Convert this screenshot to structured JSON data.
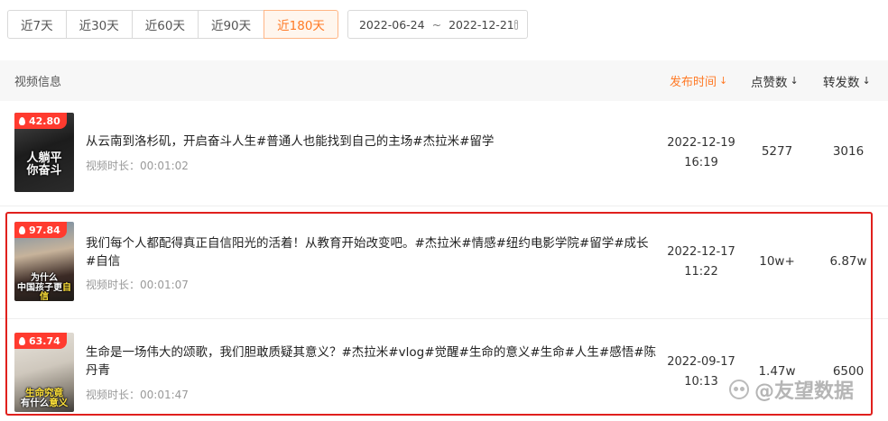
{
  "filters": {
    "ranges": [
      "近7天",
      "近30天",
      "近60天",
      "近90天",
      "近180天"
    ],
    "active_range": "近180天",
    "date_start": "2022-06-24",
    "date_separator": "~",
    "date_end": "2022-12-21"
  },
  "table": {
    "col_info": "视频信息",
    "col_publish": "发布时间",
    "col_likes": "点赞数",
    "col_shares": "转发数",
    "sort_arrow": "↓",
    "rows": [
      {
        "score": "42.80",
        "thumb_caption_line1": "人躺平",
        "thumb_caption_line2": "你奋斗",
        "title": "从云南到洛杉矶，开启奋斗人生#普通人也能找到自己的主场#杰拉米#留学",
        "duration": "视频时长：00:01:02",
        "publish_date": "2022-12-19",
        "publish_time": "16:19",
        "likes": "5277",
        "shares": "3016"
      },
      {
        "score": "97.84",
        "thumb_caption_line1": "为什么",
        "thumb_caption_line2": "中国孩子更",
        "thumb_caption_highlight": "自信",
        "title_line1": "我们每个人都配得真正自信阳光的活着！从教育开始改变吧。#杰拉米#情感#纽约电影学院#留学#成长",
        "title_line2": "#自信",
        "duration": "视频时长：00:01:07",
        "publish_date": "2022-12-17",
        "publish_time": "11:22",
        "likes": "10w+",
        "shares": "6.87w"
      },
      {
        "score": "63.74",
        "thumb_caption_line1": "生命究竟",
        "thumb_caption_line2": "有什么",
        "thumb_caption_highlight": "意义",
        "title_line1": "生命是一场伟大的颂歌，我们胆敢质疑其意义？#杰拉米#vlog#觉醒#生命的意义#生命#人生#感悟#陈",
        "title_line2": "丹青",
        "duration": "视频时长：00:01:47",
        "publish_date": "2022-09-17",
        "publish_time": "10:13",
        "likes": "1.47w",
        "shares": "6500"
      }
    ]
  },
  "watermark": {
    "text": "@友望数据"
  },
  "colors": {
    "accent": "#ff7a26",
    "badge": "#ff3b2f",
    "highlight_border": "#e0201d"
  }
}
